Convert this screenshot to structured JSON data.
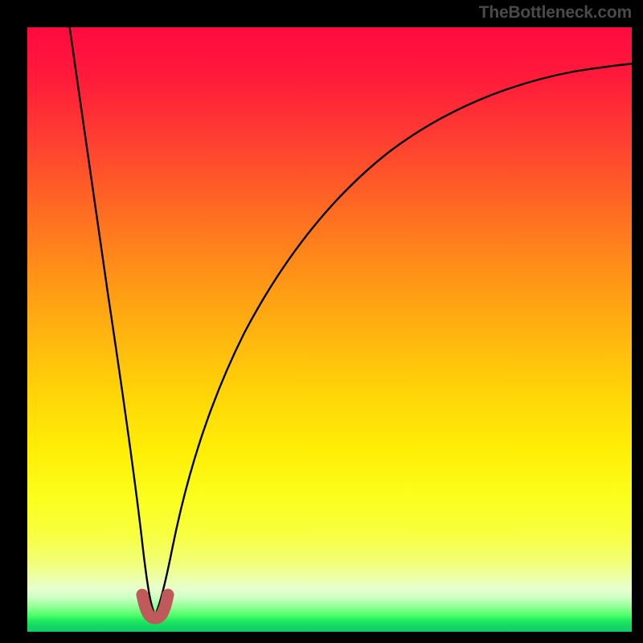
{
  "watermark": "TheBottleneck.com",
  "colors": {
    "frame_bg": "#000000",
    "curve_stroke": "#000000",
    "band_stroke": "#c05a5a",
    "gradient_top": "#ff0a40",
    "gradient_bottom": "#0fce65"
  },
  "chart_data": {
    "type": "line",
    "title": "",
    "xlabel": "",
    "ylabel": "",
    "xlim": [
      0,
      100
    ],
    "ylim": [
      0,
      100
    ],
    "grid": false,
    "legend": false,
    "annotations": [],
    "series": [
      {
        "name": "bottleneck-curve",
        "x": [
          7,
          9,
          11,
          13,
          15,
          17,
          19,
          20,
          22,
          24,
          26,
          30,
          35,
          40,
          45,
          50,
          55,
          60,
          65,
          70,
          75,
          80,
          85,
          90,
          95,
          100
        ],
        "y": [
          100,
          85,
          70,
          55,
          40,
          25,
          10,
          3,
          3,
          10,
          20,
          35,
          48,
          57,
          64,
          70,
          74,
          78,
          81,
          83.5,
          85.5,
          87,
          88.3,
          89.5,
          90.5,
          91.3
        ]
      },
      {
        "name": "highlight-band",
        "x": [
          19,
          20,
          21,
          22,
          23
        ],
        "y": [
          6,
          2.5,
          2,
          2.5,
          6
        ]
      }
    ],
    "notes": "x is horizontal position as % of plot width (0=left, 100=right); y is height above bottom as % of plot height (0=bottom, 100=top). Minimum at x≈21."
  }
}
